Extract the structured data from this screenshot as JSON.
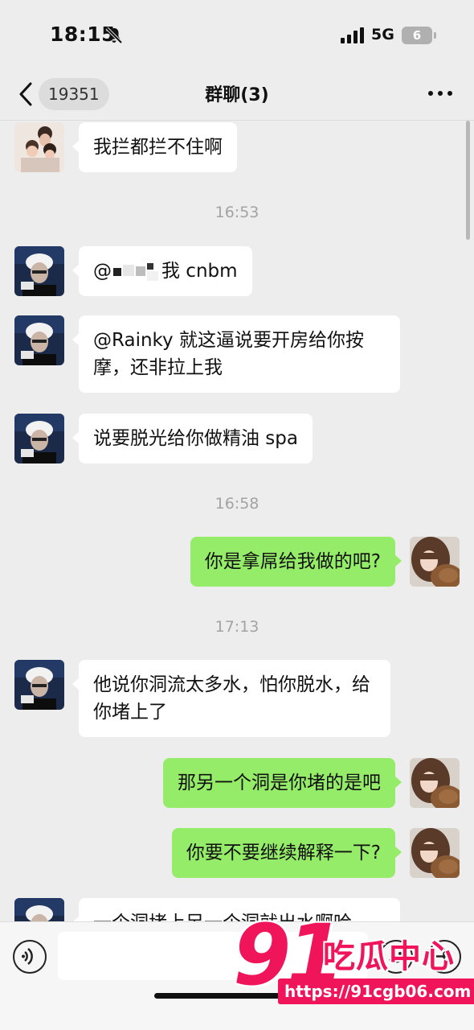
{
  "status_bar": {
    "time": "18:15",
    "network": "5G",
    "battery": "6"
  },
  "nav": {
    "unread_count": "19351",
    "title": "群聊(3)"
  },
  "messages": [
    {
      "side": "in",
      "avatar": "avatar-children-photo",
      "text": "我拦都拦不住啊"
    },
    {
      "type": "time",
      "text": "16:53"
    },
    {
      "side": "in",
      "avatar": "avatar-white-hair-portrait",
      "prefix": "@",
      "suffix": "我 cnbm"
    },
    {
      "side": "in",
      "avatar": "avatar-white-hair-portrait",
      "text": "@Rainky 就这逼说要开房给你按摩，还非拉上我"
    },
    {
      "side": "in",
      "avatar": "avatar-white-hair-portrait",
      "text": "说要脱光给你做精油 spa"
    },
    {
      "type": "time",
      "text": "16:58"
    },
    {
      "side": "out",
      "avatar": "avatar-brown-hair-girl",
      "text": "你是拿屌给我做的吧?"
    },
    {
      "type": "time",
      "text": "17:13"
    },
    {
      "side": "in",
      "avatar": "avatar-white-hair-portrait",
      "text": "他说你洞流太多水，怕你脱水，给你堵上了"
    },
    {
      "side": "out",
      "avatar": "avatar-brown-hair-girl",
      "text": "那另一个洞是你堵的是吧"
    },
    {
      "side": "out",
      "avatar": "avatar-brown-hair-girl",
      "text": "你要不要继续解释一下?"
    },
    {
      "side": "in",
      "avatar": "avatar-white-hair-portrait",
      "text": "一个洞堵上另一个洞就出水啊哈"
    }
  ],
  "watermark": {
    "number": "91",
    "name": "吃瓜中心",
    "url": "https://91cgb06.com"
  },
  "icons": [
    "bell-slash-icon",
    "signal-bars-icon",
    "back-chevron-icon",
    "more-dots-icon",
    "voice-icon",
    "emoji-icon",
    "plus-icon"
  ],
  "colors": {
    "outgoing_bubble": "#95ec69",
    "incoming_bubble": "#ffffff",
    "background": "#ededed",
    "watermark": "#f0145a"
  }
}
